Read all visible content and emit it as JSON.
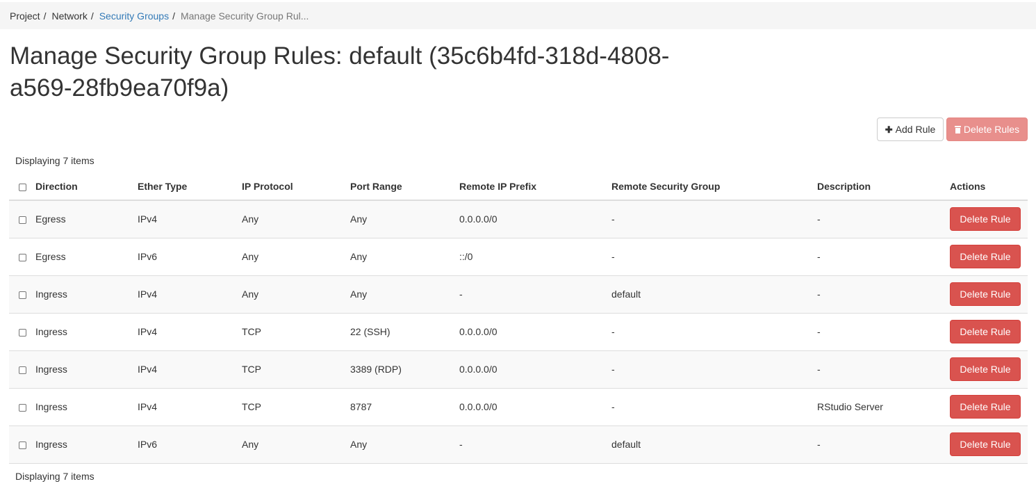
{
  "breadcrumb": [
    {
      "label": "Project"
    },
    {
      "label": "Network"
    },
    {
      "label": "Security Groups"
    },
    {
      "label": "Manage Security Group Rul..."
    }
  ],
  "page_title": "Manage Security Group Rules: default (35c6b4fd-318d-4808-a569-28fb9ea70f9a)",
  "toolbar": {
    "add_label": "Add Rule",
    "delete_label": "Delete Rules",
    "add_icon": "plus-icon",
    "delete_icon": "trash-icon"
  },
  "count_text": "Displaying 7 items",
  "table": {
    "columns": [
      "Direction",
      "Ether Type",
      "IP Protocol",
      "Port Range",
      "Remote IP Prefix",
      "Remote Security Group",
      "Description",
      "Actions"
    ],
    "rows": [
      {
        "direction": "Egress",
        "ether_type": "IPv4",
        "ip_protocol": "Any",
        "port_range": "Any",
        "remote_ip_prefix": "0.0.0.0/0",
        "remote_security_group": "-",
        "description": "-",
        "action": "Delete Rule"
      },
      {
        "direction": "Egress",
        "ether_type": "IPv6",
        "ip_protocol": "Any",
        "port_range": "Any",
        "remote_ip_prefix": "::/0",
        "remote_security_group": "-",
        "description": "-",
        "action": "Delete Rule"
      },
      {
        "direction": "Ingress",
        "ether_type": "IPv4",
        "ip_protocol": "Any",
        "port_range": "Any",
        "remote_ip_prefix": "-",
        "remote_security_group": "default",
        "description": "-",
        "action": "Delete Rule"
      },
      {
        "direction": "Ingress",
        "ether_type": "IPv4",
        "ip_protocol": "TCP",
        "port_range": "22 (SSH)",
        "remote_ip_prefix": "0.0.0.0/0",
        "remote_security_group": "-",
        "description": "-",
        "action": "Delete Rule"
      },
      {
        "direction": "Ingress",
        "ether_type": "IPv4",
        "ip_protocol": "TCP",
        "port_range": "3389 (RDP)",
        "remote_ip_prefix": "0.0.0.0/0",
        "remote_security_group": "-",
        "description": "-",
        "action": "Delete Rule"
      },
      {
        "direction": "Ingress",
        "ether_type": "IPv4",
        "ip_protocol": "TCP",
        "port_range": "8787",
        "remote_ip_prefix": "0.0.0.0/0",
        "remote_security_group": "-",
        "description": "RStudio Server",
        "action": "Delete Rule"
      },
      {
        "direction": "Ingress",
        "ether_type": "IPv6",
        "ip_protocol": "Any",
        "port_range": "Any",
        "remote_ip_prefix": "-",
        "remote_security_group": "default",
        "description": "-",
        "action": "Delete Rule"
      }
    ]
  },
  "colors": {
    "link": "#337ab7",
    "danger": "#d9534f",
    "danger_disabled": "#e88f8c",
    "breadcrumb_bg": "#f5f5f5",
    "stripe": "#f9f9f9"
  }
}
